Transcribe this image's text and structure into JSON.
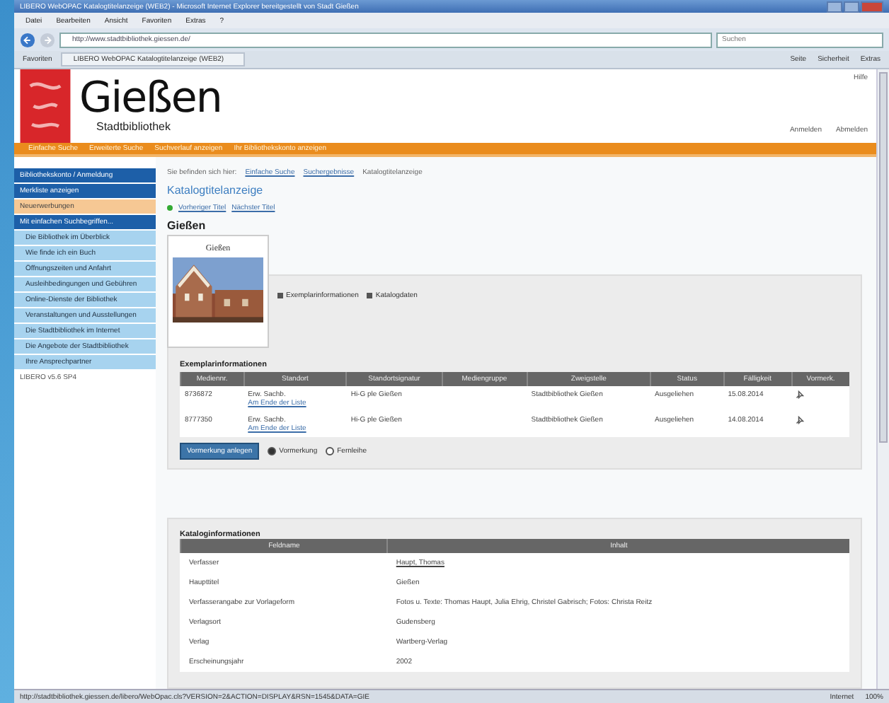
{
  "window": {
    "title": "LIBERO WebOPAC Katalogtitelanzeige (WEB2) - Microsoft Internet Explorer bereitgestellt von Stadt Gießen"
  },
  "menu": [
    "Datei",
    "Bearbeiten",
    "Ansicht",
    "Favoriten",
    "Extras",
    "?"
  ],
  "address": "http://www.stadtbibliothek.giessen.de/",
  "search_placeholder": "Suchen",
  "favorites_label": "Favoriten",
  "tab_title": "LIBERO WebOPAC Katalogtitelanzeige (WEB2)",
  "command_items": [
    "Seite",
    "Sicherheit",
    "Extras"
  ],
  "logo": {
    "title": "Gießen",
    "subtitle": "Stadtbibliothek"
  },
  "header_links": [
    "Hilfe"
  ],
  "account_links": [
    "Anmelden",
    "Abmelden"
  ],
  "nav": [
    {
      "label": "Einfache Suche",
      "selected": false
    },
    {
      "label": "Erweiterte Suche",
      "selected": false
    },
    {
      "label": "Suchverlauf anzeigen",
      "selected": false
    },
    {
      "label": "Ihr Bibliothekskonto anzeigen",
      "selected": false
    }
  ],
  "sidebar": [
    {
      "kind": "header",
      "label": "Bibliothekskonto / Anmeldung"
    },
    {
      "kind": "header",
      "label": "Merkliste anzeigen"
    },
    {
      "kind": "item",
      "label": "Neuerwerbungen",
      "selected": true
    },
    {
      "kind": "header",
      "label": "Mit einfachen Suchbegriffen..."
    },
    {
      "kind": "item",
      "label": "Die Bibliothek im Überblick",
      "selected": false
    },
    {
      "kind": "item",
      "label": "Wie finde ich ein Buch",
      "selected": false
    },
    {
      "kind": "item",
      "label": "Öffnungszeiten und Anfahrt",
      "selected": false
    },
    {
      "kind": "item",
      "label": "Ausleihbedingungen und Gebühren",
      "selected": false
    },
    {
      "kind": "item",
      "label": "Online-Dienste der Bibliothek",
      "selected": false
    },
    {
      "kind": "item",
      "label": "Veranstaltungen und Ausstellungen",
      "selected": false
    },
    {
      "kind": "item",
      "label": "Die Stadtbibliothek im Internet",
      "selected": false
    },
    {
      "kind": "item",
      "label": "Die Angebote der Stadtbibliothek",
      "selected": false
    },
    {
      "kind": "item",
      "label": "Ihre Ansprechpartner",
      "selected": false
    },
    {
      "kind": "plain",
      "label": "LIBERO v5.6 SP4"
    }
  ],
  "breadcrumb": [
    "Sie befinden sich hier:",
    "Einfache Suche",
    "Suchergebnisse",
    "Katalogtitelanzeige"
  ],
  "page_title": "Katalogtitelanzeige",
  "pager": [
    "Vorheriger Titel",
    "Nächster Titel"
  ],
  "record_title": "Gießen",
  "anchors": [
    "Exemplarinformationen",
    "Katalogdaten"
  ],
  "cover": {
    "caption": "Gießen",
    "kind": "picture"
  },
  "exemplars": {
    "title": "Exemplarinformationen",
    "columns": [
      "Mediennr.",
      "Standort",
      "Standortsignatur",
      "Mediengruppe",
      "Zweigstelle",
      "Status",
      "Fälligkeit",
      "Vormerk."
    ],
    "rows": [
      {
        "cells": [
          "8736872",
          "Erw. Sachb.",
          "Hi-G ple Gießen",
          "",
          "Stadtbibliothek Gießen",
          "Ausgeliehen",
          "15.08.2014"
        ],
        "link": "Am Ende der Liste"
      },
      {
        "cells": [
          "8777350",
          "Erw. Sachb.",
          "Hi-G ple Gießen",
          "",
          "Stadtbibliothek Gießen",
          "Ausgeliehen",
          "14.08.2014"
        ],
        "link": "Am Ende der Liste"
      }
    ]
  },
  "reserve_button": "Vormerkung anlegen",
  "reserve_options": [
    {
      "label": "Vormerkung",
      "selected": true
    },
    {
      "label": "Fernleihe",
      "selected": false
    }
  ],
  "catalog": {
    "title": "Kataloginformationen",
    "columns": [
      "Feldname",
      "Inhalt"
    ],
    "rows": [
      {
        "label": "Verfasser",
        "value": "Haupt, Thomas",
        "link": true
      },
      {
        "label": "Haupttitel",
        "value": "Gießen",
        "link": false
      },
      {
        "label": "Verfasserangabe zur Vorlageform",
        "value": "Fotos u. Texte: Thomas Haupt, Julia Ehrig, Christel Gabrisch; Fotos: Christa Reitz",
        "link": false
      },
      {
        "label": "Verlagsort",
        "value": "Gudensberg",
        "link": false
      },
      {
        "label": "Verlag",
        "value": "Wartberg-Verlag",
        "link": false
      },
      {
        "label": "Erscheinungsjahr",
        "value": "2002",
        "link": false
      }
    ]
  },
  "status_text": "http://stadtbibliothek.giessen.de/libero/WebOpac.cls?VERSION=2&ACTION=DISPLAY&RSN=1545&DATA=GIE",
  "zone": "Internet",
  "zoom": "100%"
}
